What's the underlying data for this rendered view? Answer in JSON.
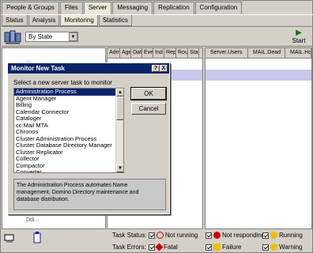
{
  "tabs_main": [
    "People & Groups",
    "Files",
    "Server",
    "Messaging",
    "Replication",
    "Configuration"
  ],
  "tabs_main_active": 2,
  "tabs_sub": [
    "Status",
    "Analysis",
    "Monitoring",
    "Statistics"
  ],
  "tabs_sub_active": 2,
  "toolbar": {
    "view_select": "By State",
    "start_label": "Start"
  },
  "left_pane": {
    "tree_fragment_top": "...",
    "tree_fragment_bottom": "Ddi..."
  },
  "mid_columns": [
    "Adm",
    "Age",
    "Dat",
    "Eve",
    "Ind",
    "Rep",
    "Rou",
    "Sta"
  ],
  "right_columns": [
    "Server.Users",
    "MAIL.Dead",
    "MAIL.Hold"
  ],
  "dialog": {
    "title": "Monitor New Task",
    "help_btn": "?",
    "close_btn": "X",
    "prompt": "Select a new server task to monitor",
    "tasks": [
      "Administration Process",
      "Agent Manager",
      "Billing",
      "Calendar Connector",
      "Cataloger",
      "cc:Mail MTA",
      "Chronos",
      "Cluster Administration Process",
      "Cluster Database Directory Manager",
      "Cluster Replicator",
      "Collector",
      "Compactor",
      "Converter"
    ],
    "selected_index": 0,
    "ok_label": "OK",
    "cancel_label": "Cancel",
    "description": "The Administration Process automates Name management, Domino Directory maintenance and database distribution."
  },
  "status_bar": {
    "task_status_label": "Task Status:",
    "task_errors_label": "Task Errors:",
    "items": [
      {
        "label": "Not running",
        "color": "#cc0000"
      },
      {
        "label": "Not responding",
        "color": "#cc0000"
      },
      {
        "label": "Running",
        "color": "#c8a000"
      },
      {
        "label": "Fatal",
        "color": "#cc0000"
      },
      {
        "label": "Failure",
        "color": "#c8a000"
      },
      {
        "label": "Warning",
        "color": "#c8a000"
      }
    ]
  }
}
